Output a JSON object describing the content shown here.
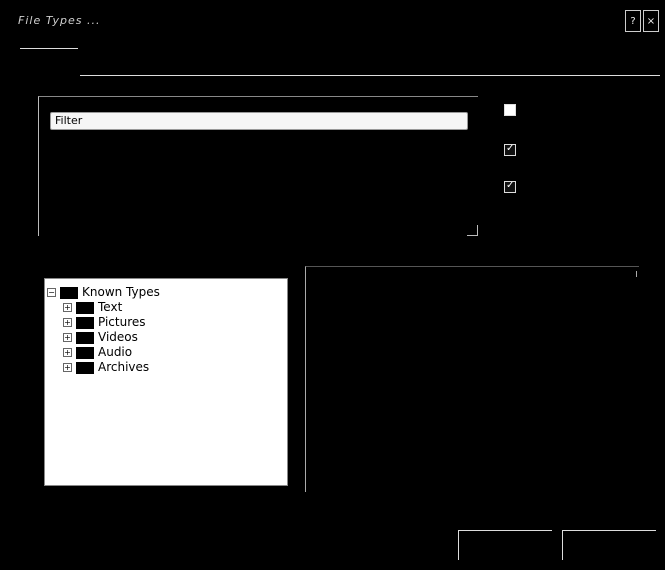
{
  "window": {
    "title": "File Types ...",
    "buttons": {
      "help": "?",
      "close": "×"
    }
  },
  "filter": {
    "value": "Filter",
    "options_visible": [
      "Filter"
    ]
  },
  "side_controls": [
    {
      "name": "checkbox-1",
      "checked": false
    },
    {
      "name": "checkbox-2",
      "checked": true
    },
    {
      "name": "checkbox-3",
      "checked": true
    }
  ],
  "tree": {
    "root": {
      "label": "Known Types",
      "expanded": true
    },
    "children": [
      {
        "label": "Text"
      },
      {
        "label": "Pictures"
      },
      {
        "label": "Videos"
      },
      {
        "label": "Audio"
      },
      {
        "label": "Archives"
      }
    ]
  },
  "buttons": {
    "ok": "",
    "cancel": ""
  },
  "colors": {
    "background": "#000000",
    "panel": "#ffffff",
    "text": "#000000"
  }
}
